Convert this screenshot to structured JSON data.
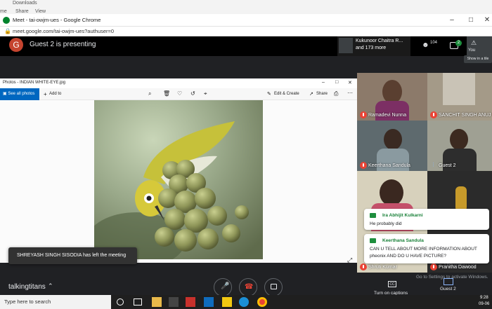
{
  "explorer": {
    "title": "Downloads",
    "tabs": [
      "me",
      "Share",
      "View"
    ]
  },
  "chrome": {
    "tab_title": "Meet - tai-owjm-ues - Google Chrome",
    "url": "meet.google.com/tai-owjm-ues?authuser=0"
  },
  "meet": {
    "presenter_initial": "G",
    "presenting_text": "Guest 2 is presenting",
    "pinned_name": "Kukunoor Chaitra R...",
    "more_text": "and 173 more",
    "people_count": "104",
    "chat_badge": "2",
    "you_label": "You",
    "show_tile_label": "Show in a tile",
    "meeting_name": "talkingtitans",
    "captions_label": "Turn on captions",
    "present_label": "Guest 2",
    "activate_windows": "Go to Settings to activate Windows.",
    "windows_watermark": "Windows",
    "toast": "SHREYASH SINGH SISODIA has left the meeting"
  },
  "photos": {
    "title": "Photos - INDIAN WHITE-EYE.jpg",
    "see_all": "See all photos",
    "add_to": "Add to",
    "edit_create": "Edit & Create",
    "share": "Share"
  },
  "participants": [
    {
      "name": "Ramadevi Nunna",
      "muted": true
    },
    {
      "name": "SANCHIT SINGH ANUJ",
      "muted": true
    },
    {
      "name": "Keerthana Sandula",
      "muted": true
    },
    {
      "name": "Guest 2",
      "muted": false
    },
    {
      "name": "Shruti Kumar",
      "muted": true
    },
    {
      "name": "Pranitha Dawood",
      "muted": true
    }
  ],
  "chat": [
    {
      "name": "Ira Abhijit Kulkarni",
      "message": "He probably did"
    },
    {
      "name": "Keerthana Sandula",
      "message": "CAN U TELL ABOUT MORE INFORMATION ABOUT pheonix AND DO U HAVE PICTURE?"
    }
  ],
  "taskbar": {
    "search_placeholder": "Type here to search",
    "time": "9:28",
    "date": "09-06"
  },
  "colors": {
    "meet_bg": "#202124",
    "accent_red": "#ea4335",
    "chat_green": "#188038",
    "photos_blue": "#0067c0"
  }
}
